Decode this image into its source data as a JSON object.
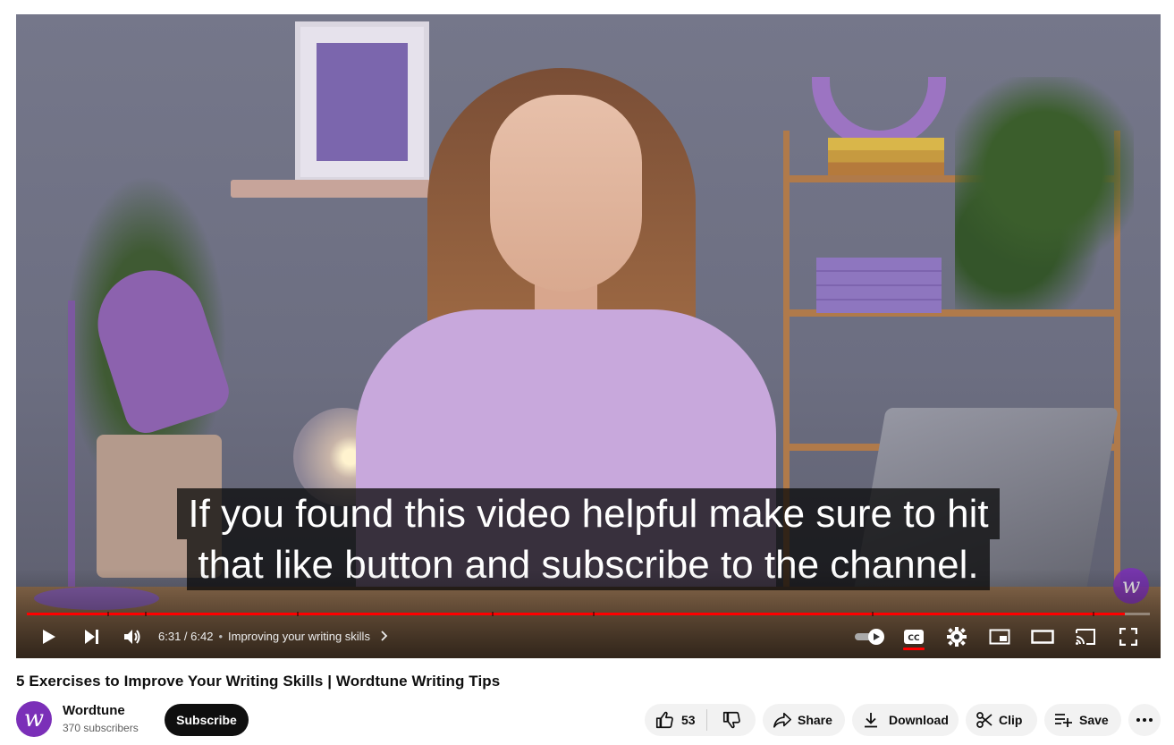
{
  "video": {
    "caption_line1": "If you found this video helpful make sure to hit",
    "caption_line2": "that like button and subscribe to the channel.",
    "progress_fraction": 0.978,
    "time": "6:31 / 6:42",
    "chapter": "Improving your writing skills",
    "watermark": "w",
    "icons": [
      "play-icon",
      "next-icon",
      "volume-icon",
      "chevron-right-icon",
      "autoplay-toggle-icon",
      "cc-icon",
      "settings-icon",
      "miniplayer-icon",
      "theater-icon",
      "cast-icon",
      "fullscreen-icon"
    ],
    "accent_color": "#ff0000"
  },
  "title": "5 Exercises to Improve Your Writing Skills | Wordtune Writing Tips",
  "channel": {
    "avatar_letter": "w",
    "name": "Wordtune",
    "subscribers": "370 subscribers",
    "subscribe_label": "Subscribe",
    "brand_color": "#7b2fb8"
  },
  "actions": {
    "like_count": "53",
    "share": "Share",
    "download": "Download",
    "clip": "Clip",
    "save": "Save",
    "icons": [
      "thumbs-up-icon",
      "thumbs-down-icon",
      "share-icon",
      "download-icon",
      "scissors-icon",
      "playlist-add-icon",
      "more-icon"
    ]
  }
}
